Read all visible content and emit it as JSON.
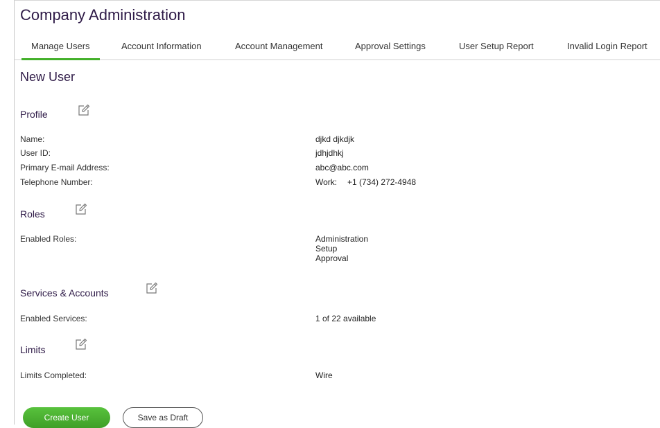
{
  "header": {
    "title": "Company Administration"
  },
  "tabs": [
    {
      "label": "Manage Users",
      "active": true
    },
    {
      "label": "Account Information"
    },
    {
      "label": "Account Management"
    },
    {
      "label": "Approval Settings"
    },
    {
      "label": "User Setup Report"
    },
    {
      "label": "Invalid Login Report"
    }
  ],
  "main": {
    "title": "New User",
    "profile": {
      "title": "Profile",
      "name_label": "Name:",
      "name_value": "djkd djkdjk",
      "userid_label": "User ID:",
      "userid_value": "jdhjdhkj",
      "email_label": "Primary E-mail Address:",
      "email_value": "abc@abc.com",
      "phone_label": "Telephone Number:",
      "phone_type": "Work:",
      "phone_value": "+1 (734) 272-4948"
    },
    "roles": {
      "title": "Roles",
      "label": "Enabled Roles:",
      "values": [
        "Administration",
        "Setup",
        "Approval"
      ]
    },
    "services": {
      "title": "Services & Accounts",
      "label": "Enabled Services:",
      "value": "1 of 22 available"
    },
    "limits": {
      "title": "Limits",
      "label": "Limits Completed:",
      "value": "Wire"
    }
  },
  "actions": {
    "create_label": "Create User",
    "draft_label": "Save as Draft"
  },
  "colors": {
    "accent_green": "#43b02a",
    "heading_purple": "#2e1a47"
  },
  "icons": {
    "edit": "edit-pencil-icon"
  }
}
